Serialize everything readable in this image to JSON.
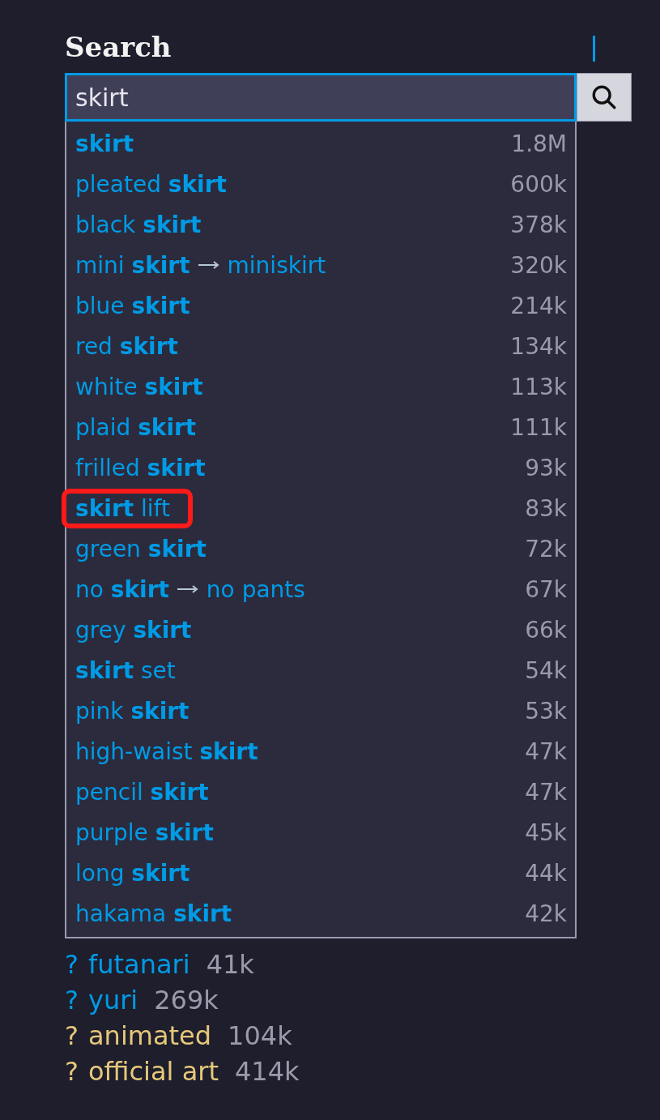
{
  "heading": "Search",
  "search": {
    "value": "skirt"
  },
  "suggestions": [
    {
      "label": "**skirt**",
      "count": "1.8M",
      "highlighted": false
    },
    {
      "label": "pleated **skirt**",
      "count": "600k",
      "highlighted": false
    },
    {
      "label": "black **skirt**",
      "count": "378k",
      "highlighted": false
    },
    {
      "label": "mini **skirt**",
      "alias": "miniskirt",
      "count": "320k",
      "highlighted": false
    },
    {
      "label": "blue **skirt**",
      "count": "214k",
      "highlighted": false
    },
    {
      "label": "red **skirt**",
      "count": "134k",
      "highlighted": false
    },
    {
      "label": "white **skirt**",
      "count": "113k",
      "highlighted": false
    },
    {
      "label": "plaid **skirt**",
      "count": "111k",
      "highlighted": false
    },
    {
      "label": "frilled **skirt**",
      "count": "93k",
      "highlighted": false
    },
    {
      "label": "**skirt** lift",
      "count": "83k",
      "highlighted": true
    },
    {
      "label": "green **skirt**",
      "count": "72k",
      "highlighted": false
    },
    {
      "label": "no **skirt**",
      "alias": "no pants",
      "count": "67k",
      "highlighted": false
    },
    {
      "label": "grey **skirt**",
      "count": "66k",
      "highlighted": false
    },
    {
      "label": "**skirt** set",
      "count": "54k",
      "highlighted": false
    },
    {
      "label": "pink **skirt**",
      "count": "53k",
      "highlighted": false
    },
    {
      "label": "high-waist **skirt**",
      "count": "47k",
      "highlighted": false
    },
    {
      "label": "pencil **skirt**",
      "count": "47k",
      "highlighted": false
    },
    {
      "label": "purple **skirt**",
      "count": "45k",
      "highlighted": false
    },
    {
      "label": "long **skirt**",
      "count": "44k",
      "highlighted": false
    },
    {
      "label": "hakama **skirt**",
      "count": "42k",
      "highlighted": false
    }
  ],
  "tags": [
    {
      "help": "?",
      "name": "futanari",
      "count": "41k",
      "color": "#009be6"
    },
    {
      "help": "?",
      "name": "yuri",
      "count": "269k",
      "color": "#009be6"
    },
    {
      "help": "?",
      "name": "animated",
      "count": "104k",
      "color": "#e6c87a"
    },
    {
      "help": "?",
      "name": "official art",
      "count": "414k",
      "color": "#e6c87a"
    }
  ]
}
